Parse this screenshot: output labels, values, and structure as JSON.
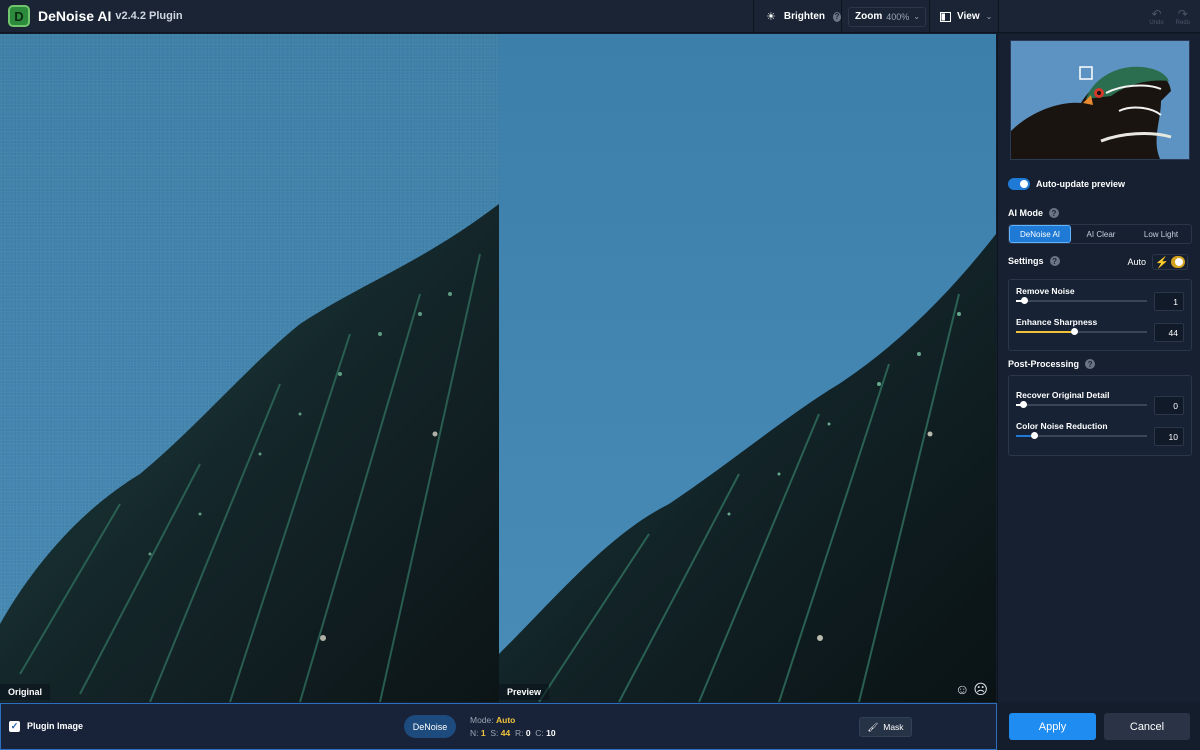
{
  "app": {
    "title": "DeNoise AI",
    "version": "v2.4.2 Plugin",
    "logo_letter": "D"
  },
  "toolbar": {
    "brighten_label": "Brighten",
    "zoom_label": "Zoom",
    "zoom_value": "400%",
    "view_label": "View",
    "undo_label": "Undo",
    "redo_label": "Redo"
  },
  "panes": {
    "original_label": "Original",
    "preview_label": "Preview"
  },
  "panel": {
    "auto_update_label": "Auto-update preview",
    "ai_mode_label": "AI Mode",
    "modes": [
      "DeNoise AI",
      "AI Clear",
      "Low Light"
    ],
    "active_mode": "DeNoise AI",
    "settings_label": "Settings",
    "auto_label": "Auto",
    "sliders": [
      {
        "label": "Remove Noise",
        "value": "1",
        "fraction": 0.06,
        "color": "#ffffff"
      },
      {
        "label": "Enhance Sharpness",
        "value": "44",
        "fraction": 0.44,
        "color": "#f0c23a"
      }
    ],
    "post_processing_label": "Post-Processing",
    "post_sliders": [
      {
        "label": "Recover Original Detail",
        "value": "0",
        "fraction": 0.05,
        "color": "#ffffff"
      },
      {
        "label": "Color Noise Reduction",
        "value": "10",
        "fraction": 0.14,
        "color": "#1f7ad6"
      }
    ]
  },
  "bottom": {
    "plugin_image_label": "Plugin Image",
    "denoise_pill": "DeNoise",
    "mode_prefix": "Mode:",
    "mode_value": "Auto",
    "n_label": "N:",
    "n_value": "1",
    "s_label": "S:",
    "s_value": "44",
    "r_label": "R:",
    "r_value": "0",
    "c_label": "C:",
    "c_value": "10",
    "mask_label": "Mask",
    "apply_label": "Apply",
    "cancel_label": "Cancel"
  },
  "colors": {
    "accent": "#1e8cf0",
    "sharpness": "#f0c23a",
    "background": "#141d2b"
  }
}
